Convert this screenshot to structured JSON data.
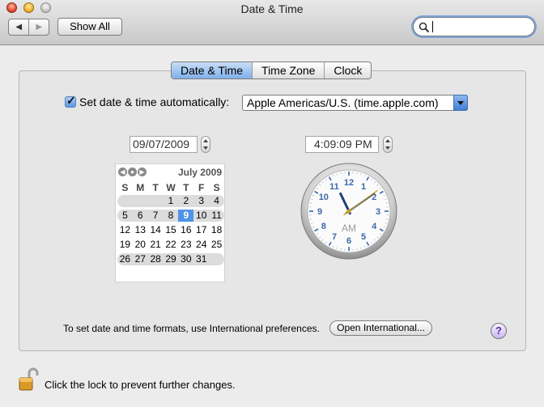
{
  "window": {
    "title": "Date & Time"
  },
  "toolbar": {
    "back_glyph": "◀",
    "forward_glyph": "▶",
    "show_all": "Show All",
    "search_value": ""
  },
  "tabs": [
    {
      "label": "Date & Time",
      "active": true
    },
    {
      "label": "Time Zone",
      "active": false
    },
    {
      "label": "Clock",
      "active": false
    }
  ],
  "auto": {
    "checked": true,
    "label": "Set date & time automatically:",
    "server": "Apple Americas/U.S. (time.apple.com)"
  },
  "date_value": "09/07/2009",
  "time_value": "4:09:09  PM",
  "calendar": {
    "month": "July 2009",
    "weekdays": [
      "S",
      "M",
      "T",
      "W",
      "T",
      "F",
      "S"
    ],
    "weeks": [
      [
        "",
        "",
        "",
        "1",
        "2",
        "3",
        "4"
      ],
      [
        "5",
        "6",
        "7",
        "8",
        "9",
        "10",
        "11"
      ],
      [
        "12",
        "13",
        "14",
        "15",
        "16",
        "17",
        "18"
      ],
      [
        "19",
        "20",
        "21",
        "22",
        "23",
        "24",
        "25"
      ],
      [
        "26",
        "27",
        "28",
        "29",
        "30",
        "31",
        ""
      ]
    ],
    "selected_day": "9"
  },
  "clock": {
    "numbers": [
      "12",
      "1",
      "2",
      "3",
      "4",
      "5",
      "6",
      "7",
      "8",
      "9",
      "10",
      "11"
    ],
    "period": "AM",
    "hour": 11,
    "minute": 9,
    "second": 9
  },
  "footer": {
    "info": "To set date and time formats, use International preferences.",
    "open_button": "Open International...",
    "help": "?",
    "lock_text": "Click the lock to prevent further changes."
  },
  "colors": {
    "accent": "#4f93e8",
    "clock_numbers": "#3b68a8",
    "second_hand": "#c8a020"
  }
}
